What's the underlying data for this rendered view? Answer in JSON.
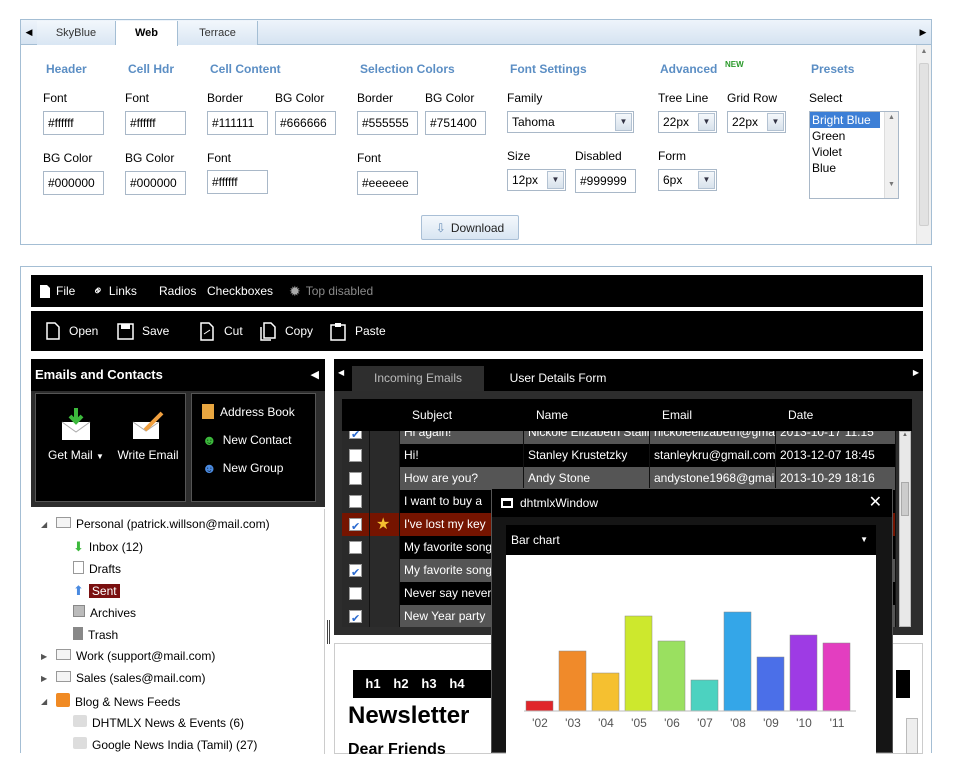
{
  "config": {
    "tabs": [
      "SkyBlue",
      "Web",
      "Terrace"
    ],
    "active_tab": "Web",
    "sections": {
      "header": "Header",
      "cell_hdr": "Cell Hdr",
      "cell_content": "Cell Content",
      "selection_colors": "Selection Colors",
      "font_settings": "Font Settings",
      "advanced": "Advanced",
      "advanced_badge": "NEW",
      "presets": "Presets"
    },
    "fields": {
      "header_font_label": "Font",
      "header_font": "#ffffff",
      "header_bg_label": "BG Color",
      "header_bg": "#000000",
      "cellhdr_font_label": "Font",
      "cellhdr_font": "#ffffff",
      "cellhdr_bg_label": "BG Color",
      "cellhdr_bg": "#000000",
      "cell_border_label": "Border",
      "cell_border": "#111111",
      "cell_bg_label": "BG Color",
      "cell_bg": "#666666",
      "cell_font_label": "Font",
      "cell_font": "#ffffff",
      "sel_border_label": "Border",
      "sel_border": "#555555",
      "sel_bg_label": "BG Color",
      "sel_bg": "#751400",
      "sel_font_label": "Font",
      "sel_font": "#eeeeee",
      "family_label": "Family",
      "family": "Tahoma",
      "size_label": "Size",
      "size": "12px",
      "disabled_label": "Disabled",
      "disabled": "#999999",
      "tree_line_label": "Tree Line",
      "tree_line": "22px",
      "grid_row_label": "Grid Row",
      "grid_row": "22px",
      "form_label": "Form",
      "form": "6px",
      "select_label": "Select"
    },
    "presets": [
      "Bright Blue",
      "Green",
      "Violet",
      "Blue"
    ],
    "download_label": "Download"
  },
  "menu": {
    "file": "File",
    "links": "Links",
    "radios": "Radios",
    "checkboxes": "Checkboxes",
    "top_disabled": "Top disabled"
  },
  "toolbar": {
    "open": "Open",
    "save": "Save",
    "cut": "Cut",
    "copy": "Copy",
    "paste": "Paste"
  },
  "left": {
    "title": "Emails and Contacts",
    "get_mail": "Get Mail",
    "write_email": "Write Email",
    "address_book": "Address Book",
    "new_contact": "New Contact",
    "new_group": "New Group"
  },
  "tree": [
    {
      "label": "Personal (patrick.willson@mail.com)",
      "level": 0,
      "exp": "◢",
      "icon": "envelope-icon"
    },
    {
      "label": "Inbox (12)",
      "level": 1,
      "icon": "inbox-icon"
    },
    {
      "label": "Drafts",
      "level": 1,
      "icon": "drafts-icon"
    },
    {
      "label": "Sent",
      "level": 1,
      "icon": "sent-icon",
      "selected": true
    },
    {
      "label": "Archives",
      "level": 1,
      "icon": "archives-icon"
    },
    {
      "label": "Trash",
      "level": 1,
      "icon": "trash-icon"
    },
    {
      "label": "Work (support@mail.com)",
      "level": 0,
      "exp": "▶",
      "icon": "envelope-icon"
    },
    {
      "label": "Sales (sales@mail.com)",
      "level": 0,
      "exp": "▶",
      "icon": "envelope-icon"
    },
    {
      "label": "Blog & News Feeds",
      "level": 0,
      "exp": "◢",
      "icon": "rss-icon"
    },
    {
      "label": "DHTMLX News & Events (6)",
      "level": 1,
      "icon": "feed-icon"
    },
    {
      "label": "Google News India (Tamil) (27)",
      "level": 1,
      "icon": "feed-icon"
    }
  ],
  "tabs": {
    "incoming": "Incoming Emails",
    "user_details": "User Details Form"
  },
  "grid": {
    "headers": {
      "subject": "Subject",
      "name": "Name",
      "email": "Email",
      "date": "Date"
    },
    "rows": [
      {
        "checked": true,
        "star": false,
        "subject": "Hi again!",
        "name": "Nickole Elizabeth Stallion",
        "email": "nickoleelizabeth@gmail.com",
        "date": "2013-10-17 11:15"
      },
      {
        "checked": false,
        "star": false,
        "subject": "Hi!",
        "name": "Stanley Krustetzky",
        "email": "stanleykru@gmail.com",
        "date": "2013-12-07 18:45"
      },
      {
        "checked": false,
        "star": false,
        "subject": "How are you?",
        "name": "Andy Stone",
        "email": "andystone1968@gmail.com",
        "date": "2013-10-29 18:16"
      },
      {
        "checked": false,
        "star": false,
        "subject": "I want to buy a",
        "name": "",
        "email": "",
        "date": ""
      },
      {
        "checked": true,
        "star": true,
        "subject": "I've lost my key",
        "name": "",
        "email": "",
        "date": "",
        "selected": true
      },
      {
        "checked": false,
        "star": false,
        "subject": "My favorite song",
        "name": "",
        "email": "",
        "date": ""
      },
      {
        "checked": true,
        "star": false,
        "subject": "My favorite song",
        "name": "",
        "email": "",
        "date": ""
      },
      {
        "checked": false,
        "star": false,
        "subject": "Never say never",
        "name": "",
        "email": "",
        "date": ""
      },
      {
        "checked": true,
        "star": false,
        "subject": "New Year party",
        "name": "",
        "email": "",
        "date": ""
      }
    ]
  },
  "editor": {
    "buttons": [
      "h1",
      "h2",
      "h3",
      "h4"
    ],
    "heading": "Newsletter",
    "subheading": "Dear Friends"
  },
  "window": {
    "title": "dhtmlxWindow",
    "chart_selector": "Bar chart"
  },
  "chart_data": {
    "type": "bar",
    "categories": [
      "'02",
      "'03",
      "'04",
      "'05",
      "'06",
      "'07",
      "'08",
      "'09",
      "'10",
      "'11"
    ],
    "values": [
      10,
      60,
      38,
      95,
      70,
      31,
      99,
      54,
      76,
      68
    ],
    "colors": [
      "#e0262a",
      "#f08a2a",
      "#f5c030",
      "#cde82d",
      "#9ae060",
      "#4cd2c0",
      "#34a6e8",
      "#4b6fe8",
      "#9e3be4",
      "#e33ec0"
    ],
    "ylim": [
      0,
      100
    ],
    "grid": false
  }
}
